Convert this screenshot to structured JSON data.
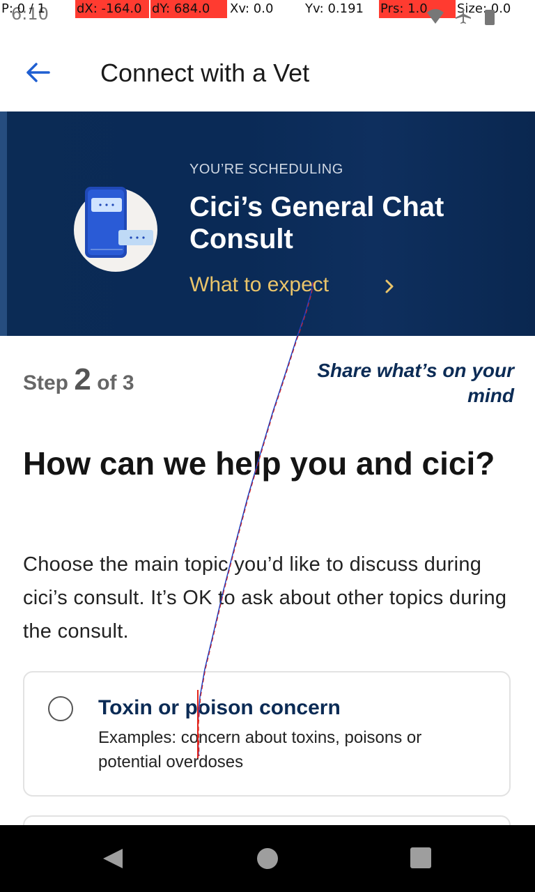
{
  "status_bar": {
    "time": "6:10",
    "pointer": {
      "p": "P: 0 / 1",
      "dx": "dX: -164.0",
      "dy": "dY: 684.0",
      "xv": "Xv: 0.0",
      "yv": "Yv: 0.191",
      "prs": "Prs: 1.0",
      "size": "Size: 0.0"
    }
  },
  "app_bar": {
    "title": "Connect with a Vet",
    "back_icon": "arrow-left-icon"
  },
  "hero": {
    "eyebrow": "YOU’RE SCHEDULING",
    "title": "Cici’s General Chat Consult",
    "link": "What to expect",
    "illustration": "chat-phone-illustration"
  },
  "step": {
    "prefix": "Step",
    "current": "2",
    "of": "of 3",
    "description": "Share what’s on your mind"
  },
  "heading": "How can we help you and cici?",
  "body": "Choose the main topic you’d like to discuss during cici’s consult. It’s OK to ask about other topics during the consult.",
  "options": [
    {
      "title": "Toxin or poison concern",
      "description": "Examples: concern about toxins, poisons or potential overdoses",
      "selected": false
    }
  ],
  "colors": {
    "hero_bg": "#0b2b55",
    "link_gold": "#e9c46a",
    "accent_blue": "#1f5fd1",
    "navy_text": "#0b2b55"
  }
}
